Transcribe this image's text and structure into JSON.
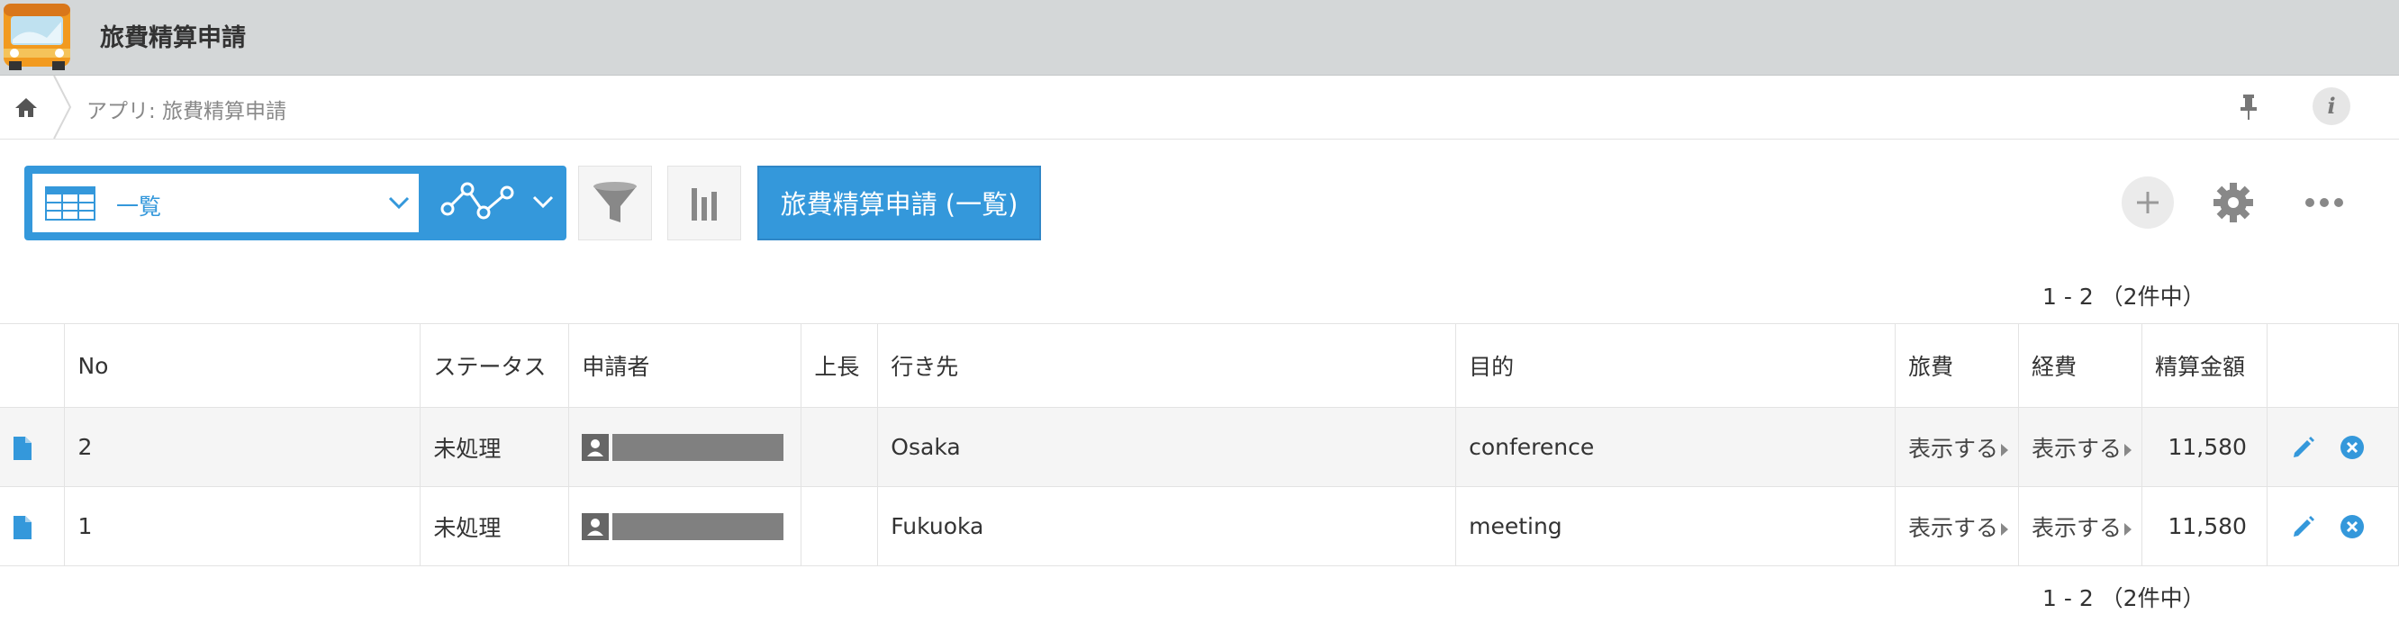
{
  "header": {
    "app_title": "旅費精算申請",
    "app_icon": "bus-icon"
  },
  "breadcrumb": {
    "text": "アプリ: 旅費精算申請"
  },
  "info_icon_glyph": "i",
  "toolbar": {
    "view_select_value": "一覧",
    "custom_view_label": "旅費精算申請 (一覧)"
  },
  "pagination": {
    "top": "1 - 2 （2件中）",
    "bottom": "1 - 2 （2件中）"
  },
  "table": {
    "columns": [
      "",
      "No",
      "ステータス",
      "申請者",
      "上長",
      "行き先",
      "目的",
      "旅費",
      "経費",
      "精算金額",
      ""
    ],
    "rows": [
      {
        "no": "2",
        "status": "未処理",
        "destination": "Osaka",
        "purpose": "conference",
        "travel": "表示する",
        "expense": "表示する",
        "amount": "11,580"
      },
      {
        "no": "1",
        "status": "未処理",
        "destination": "Fukuoka",
        "purpose": "meeting",
        "travel": "表示する",
        "expense": "表示する",
        "amount": "11,580"
      }
    ]
  },
  "colors": {
    "accent": "#3498db",
    "header_bg": "#d4d7d8",
    "row_alt": "#f5f5f5"
  }
}
